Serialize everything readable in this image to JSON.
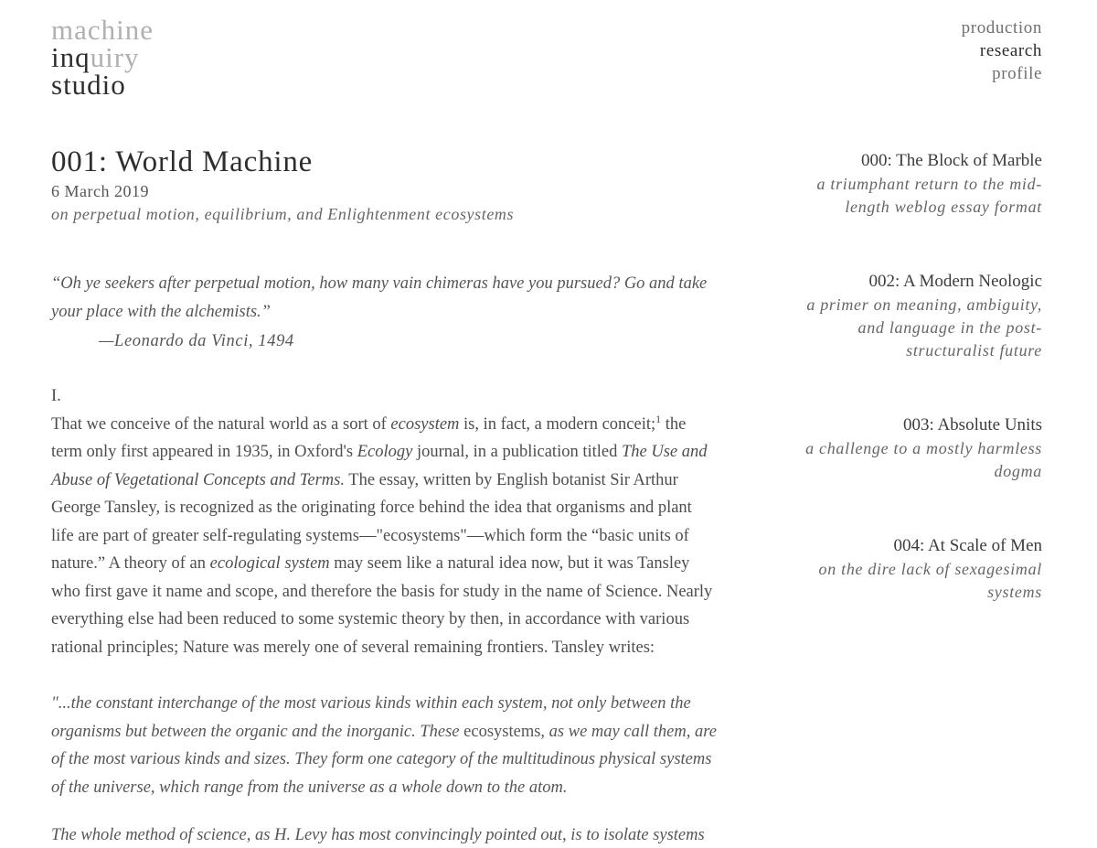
{
  "logo": {
    "line1": "machine",
    "line2_dark": "inq",
    "line2_light": "uiry",
    "line3": "studio"
  },
  "nav": {
    "items": [
      "production",
      "research",
      "profile"
    ],
    "active": "research"
  },
  "article": {
    "title": "001: World Machine",
    "date": "6 March 2019",
    "subtitle": "on perpetual motion, equilibrium, and Enlightenment ecosystems",
    "epigraph": {
      "quote": "“Oh ye seekers after perpetual motion, how many vain chimeras have you pursued? Go and take your place with the alchemists.”",
      "attribution": "—Leonardo da Vinci, 1494"
    },
    "section_numeral": "I.",
    "para1": {
      "s1": "That we conceive of the natural world as a sort of ",
      "e1": "ecosystem",
      "s2": " is, in fact, a modern conceit;",
      "footnote": "1",
      "s3": " the term only first appeared in 1935, in Oxford's ",
      "e2": "Ecology",
      "s4": " journal, in a publication titled ",
      "e3": "The Use and Abuse of Vegetational Concepts and Terms.",
      "s5": " The essay, written by English botanist Sir Arthur George Tansley, is recognized as the originating force behind the idea that organisms and plant life are part of greater self-regulating systems—\"ecosystems\"—which form the “basic units of nature.” A theory of an ",
      "e4": "ecological system",
      "s6": " may seem like a natural idea now, but it was Tansley who first gave it name and scope, and therefore the basis for study in the name of Science. Nearly everything else had been reduced to some systemic theory by then, in accordance with various rational principles; Nature was merely one of several remaining frontiers. Tansley writes:"
    },
    "quote1": {
      "a": "\"...the constant interchange of the most various kinds within each system, not only between the organisms but between the organic and the inorganic. These ",
      "b": "ecosystems,",
      "c": " as we may call them, are of the most various kinds and sizes. They form one category of the multitudinous physical systems of the universe, which range from the universe as a whole down to the atom."
    },
    "quote2": "The whole method of science, as H. Levy has most convincingly pointed out, is to isolate systems"
  },
  "sidebar": [
    {
      "title": "000: The Block of Marble",
      "desc": "a triumphant return to the mid-length weblog essay format"
    },
    {
      "title": "002: A Modern Neologic",
      "desc": "a primer on meaning, ambiguity, and language in the post-structuralist future"
    },
    {
      "title": "003: Absolute Units",
      "desc": "a challenge to a mostly harmless dogma"
    },
    {
      "title": "004: At Scale of Men",
      "desc": "on the dire lack of sexagesimal systems"
    }
  ]
}
